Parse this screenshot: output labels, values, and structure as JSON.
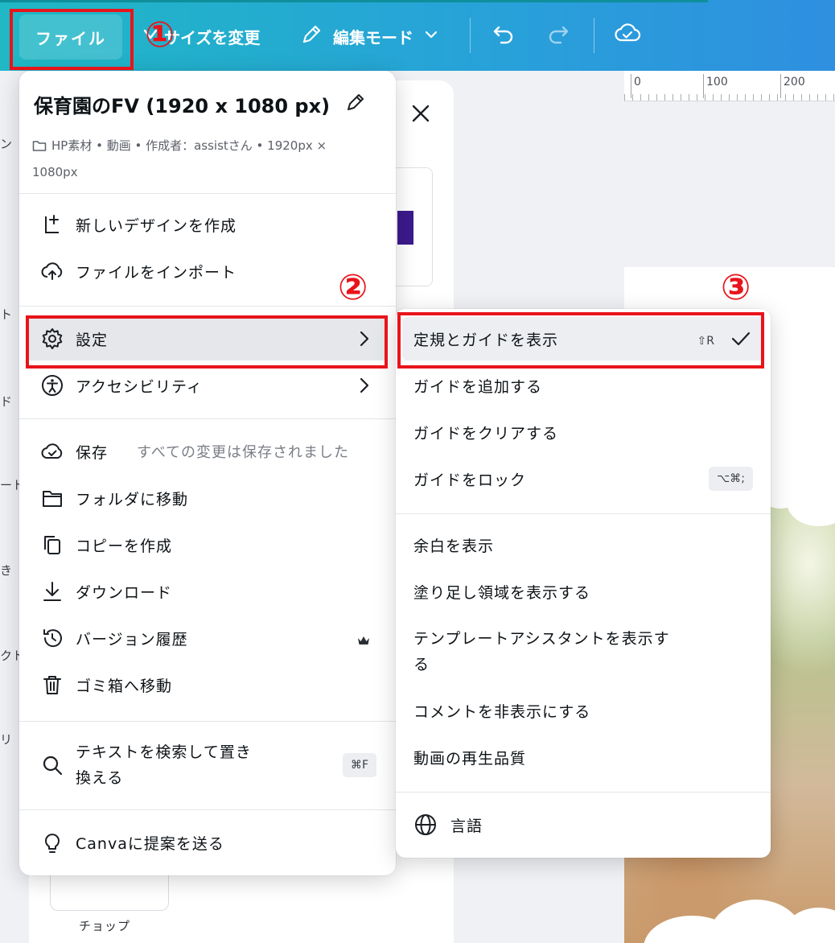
{
  "toolbar": {
    "file_label": "ファイル",
    "resize_label": "サイズを変更",
    "edit_mode_label": "編集モード"
  },
  "ruler": {
    "labels": [
      "0",
      "100",
      "200"
    ]
  },
  "left_strip": [
    "ン",
    "ト",
    "ド",
    "ート",
    "き",
    "クト",
    "リ"
  ],
  "side_panel": {
    "thumb_label": "チョップ"
  },
  "file_menu": {
    "title": "保育園のFV (1920 x 1080 px)",
    "meta": "HP素材 • 動画 • 作成者：assistさん • 1920px × 1080px",
    "items": {
      "new_design": "新しいデザインを作成",
      "import": "ファイルをインポート",
      "settings": "設定",
      "accessibility": "アクセシビリティ",
      "save": "保存",
      "save_status": "すべての変更は保存されました",
      "move_folder": "フォルダに移動",
      "copy": "コピーを作成",
      "download": "ダウンロード",
      "version_history": "バージョン履歴",
      "trash": "ゴミ箱へ移動",
      "find_replace": "テキストを検索して置き換える",
      "find_replace_shortcut": "⌘F",
      "feedback": "Canvaに提案を送る"
    }
  },
  "settings_menu": {
    "items": {
      "show_rulers": "定規とガイドを表示",
      "show_rulers_shortcut": "⇧R",
      "add_guide": "ガイドを追加する",
      "clear_guides": "ガイドをクリアする",
      "lock_guides": "ガイドをロック",
      "lock_guides_shortcut": "⌥⌘;",
      "show_margins": "余白を表示",
      "show_bleed": "塗り足し領域を表示する",
      "show_template_assistant": "テンプレートアシスタントを表示する",
      "hide_comments": "コメントを非表示にする",
      "video_quality": "動画の再生品質",
      "language": "言語"
    }
  },
  "annotations": {
    "step1": "①",
    "step2": "②",
    "step3": "③"
  },
  "colors": {
    "toolbar_start": "#1fb8c4",
    "toolbar_end": "#2f8fe0",
    "annotation_red": "#e8141b",
    "active_row": "#e6e7ea"
  }
}
